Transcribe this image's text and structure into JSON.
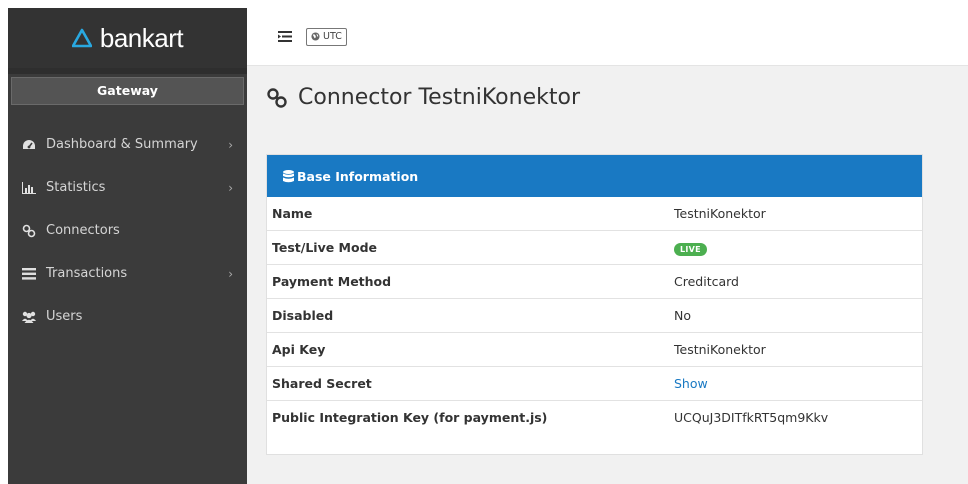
{
  "brand": {
    "name": "bankart",
    "logo_color": "#29a8e0"
  },
  "sidebar": {
    "gateway_label": "Gateway",
    "items": [
      {
        "label": "Dashboard & Summary",
        "icon": "tachometer-icon",
        "has_submenu": true
      },
      {
        "label": "Statistics",
        "icon": "bar-chart-icon",
        "has_submenu": true
      },
      {
        "label": "Connectors",
        "icon": "link-icon",
        "has_submenu": false
      },
      {
        "label": "Transactions",
        "icon": "list-icon",
        "has_submenu": true
      },
      {
        "label": "Users",
        "icon": "users-icon",
        "has_submenu": false
      }
    ]
  },
  "topbar": {
    "timezone": "UTC"
  },
  "page": {
    "title": "Connector TestniKonektor"
  },
  "panel": {
    "title": "Base Information",
    "rows": [
      {
        "key": "Name",
        "value": "TestniKonektor"
      },
      {
        "key": "Test/Live Mode",
        "value": "LIVE"
      },
      {
        "key": "Payment Method",
        "value": "Creditcard"
      },
      {
        "key": "Disabled",
        "value": "No"
      },
      {
        "key": "Api Key",
        "value": "TestniKonektor"
      },
      {
        "key": "Shared Secret",
        "value": "Show"
      },
      {
        "key": "Public Integration Key (for payment.js)",
        "value": "UCQuJ3DITfkRT5qm9Kkv"
      }
    ]
  },
  "colors": {
    "sidebar_bg": "#3b3b3b",
    "panel_header": "#1979c3",
    "live_badge": "#4caf50",
    "content_bg": "#f1f1f1"
  }
}
